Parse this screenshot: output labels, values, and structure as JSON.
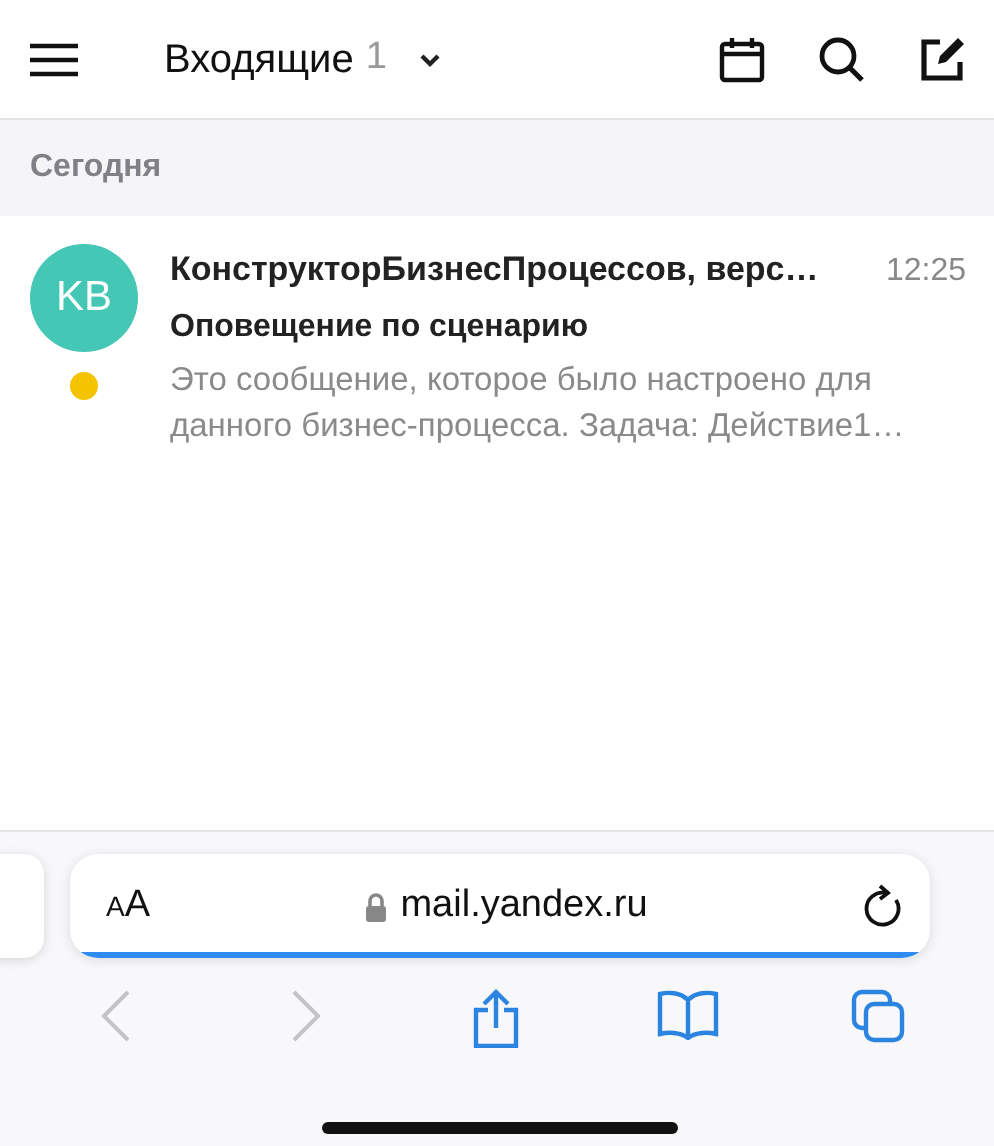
{
  "header": {
    "folder": "Входящие",
    "count": "1"
  },
  "section": "Сегодня",
  "messages": [
    {
      "initials": "KB",
      "color": "#45c7b5",
      "sender": "КонструкторБизнесПроцессов, верс…",
      "time": "12:25",
      "subject": "Оповещение по сценарию",
      "preview": "Это сообщение, которое было настроено для данного бизнес-процесса. Задача: Действие1…",
      "unread": true
    }
  ],
  "address_bar": {
    "text_size": "AA",
    "url": "mail.yandex.ru",
    "level": 1
  },
  "toolbar": [
    {
      "kind": "back",
      "disabled": true
    },
    {
      "kind": "forward",
      "disabled": true
    },
    {
      "kind": "share",
      "disabled": false
    },
    {
      "kind": "bookmarks",
      "disabled": false
    },
    {
      "kind": "tabs",
      "disabled": false
    }
  ]
}
